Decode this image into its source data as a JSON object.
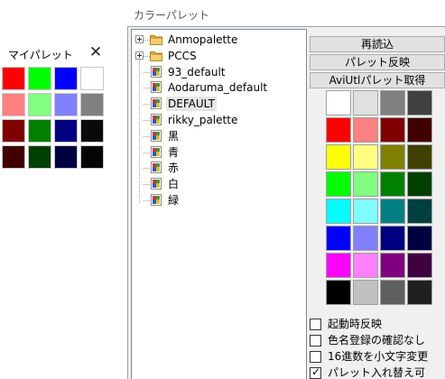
{
  "my_palette": {
    "title": "マイパレット",
    "close_glyph": "✕",
    "colors": [
      "#ff0000",
      "#00ff00",
      "#0000ff",
      "#ffffff",
      "#ff8080",
      "#80ff80",
      "#8080ff",
      "#808080",
      "#800000",
      "#008000",
      "#000080",
      "#0a0a0a",
      "#400000",
      "#004000",
      "#000040",
      "#050505"
    ]
  },
  "main": {
    "title": "カラーパレット",
    "tree": {
      "items": [
        {
          "label": "Anmopalette",
          "kind": "folder",
          "expandable": true
        },
        {
          "label": "PCCS",
          "kind": "folder",
          "expandable": true
        },
        {
          "label": "93_default",
          "kind": "palette"
        },
        {
          "label": "Aodaruma_default",
          "kind": "palette"
        },
        {
          "label": "DEFAULT",
          "kind": "palette",
          "selected": true
        },
        {
          "label": "rikky_palette",
          "kind": "palette"
        },
        {
          "label": "黒",
          "kind": "palette"
        },
        {
          "label": "青",
          "kind": "palette"
        },
        {
          "label": "赤",
          "kind": "palette"
        },
        {
          "label": "白",
          "kind": "palette"
        },
        {
          "label": "緑",
          "kind": "palette"
        }
      ]
    },
    "buttons": {
      "reload": "再読込",
      "reflect_palette": "パレット反映",
      "get_aviutl_palette": "AviUtlパレット取得"
    },
    "palette_colors": [
      "#ffffff",
      "#e0e0e0",
      "#808080",
      "#404040",
      "#ff0000",
      "#ff8080",
      "#800000",
      "#400000",
      "#ffff00",
      "#ffff80",
      "#808000",
      "#404000",
      "#00ff00",
      "#80ff80",
      "#008000",
      "#004000",
      "#00ffff",
      "#80ffff",
      "#008080",
      "#004040",
      "#0000ff",
      "#8080ff",
      "#000080",
      "#000040",
      "#ff00ff",
      "#ff80ff",
      "#800080",
      "#400040",
      "#000000",
      "#c0c0c0",
      "#606060",
      "#202020"
    ],
    "options": [
      {
        "label": "起動時反映",
        "checked": false
      },
      {
        "label": "色名登録の確認なし",
        "checked": false
      },
      {
        "label": "16進数を小文字変更",
        "checked": false
      },
      {
        "label": "パレット入れ替え可",
        "checked": true
      }
    ]
  }
}
